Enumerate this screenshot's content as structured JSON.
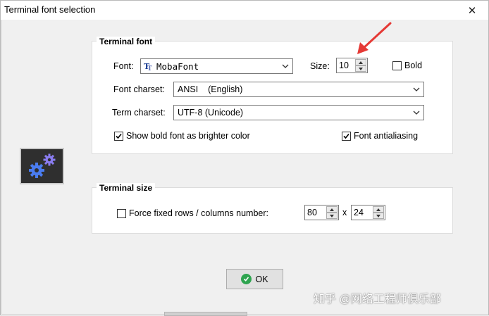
{
  "window": {
    "title": "Terminal font selection",
    "close_glyph": "✕"
  },
  "terminal_font": {
    "group_title": "Terminal font",
    "font_label": "Font:",
    "font_value": "MobaFont",
    "size_label": "Size:",
    "size_value": "10",
    "bold_label": "Bold",
    "bold_checked": false,
    "charset_label": "Font charset:",
    "charset_value": "ANSI    (English)",
    "term_charset_label": "Term charset:",
    "term_charset_value": "UTF-8 (Unicode)",
    "show_bold_label": "Show bold font as brighter color",
    "show_bold_checked": true,
    "antialias_label": "Font antialiasing",
    "antialias_checked": true
  },
  "terminal_size": {
    "group_title": "Terminal size",
    "force_label": "Force fixed rows / columns number:",
    "force_checked": false,
    "columns_value": "80",
    "separator": "x",
    "rows_value": "24"
  },
  "ok_button": {
    "label": "OK"
  },
  "watermark": "知乎 @网络工程师俱乐部",
  "icons": {
    "font_type_icon": "truetype-font-icon",
    "settings_icon": "gears-icon",
    "ok_icon": "check-circle-icon",
    "annotation": "red-arrow-pointer"
  },
  "colors": {
    "accent_arrow": "#e53935",
    "ok_green": "#2ea44f",
    "gear_blue": "#4a7cf0",
    "gear_purple": "#8a7cf0"
  }
}
